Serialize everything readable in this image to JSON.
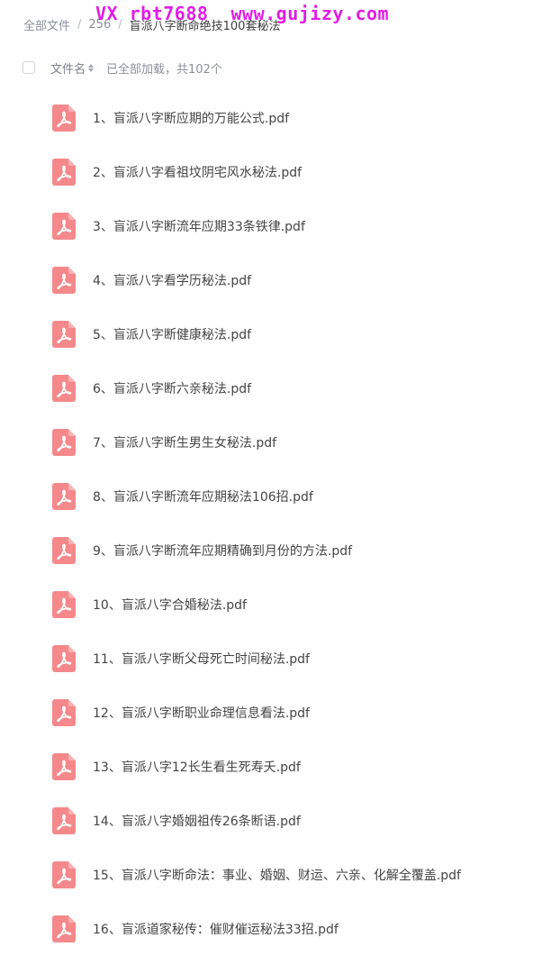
{
  "breadcrumb": {
    "root": "全部文件",
    "middle": "256",
    "current": "盲派八字断命绝技100套秘法",
    "separator": "/"
  },
  "watermark": {
    "text": "VX rbt7688  www.gujizy.com",
    "color": "#e21ce6"
  },
  "header": {
    "column_name": "文件名",
    "status": "已全部加载，共102个"
  },
  "colors": {
    "pdf_icon": "#f5888a",
    "accent": "#e21ce6"
  },
  "files": [
    {
      "name": "1、盲派八字断应期的万能公式.pdf",
      "icon": "pdf-icon"
    },
    {
      "name": "2、盲派八字看祖坟阴宅风水秘法.pdf",
      "icon": "pdf-icon"
    },
    {
      "name": "3、盲派八字断流年应期33条铁律.pdf",
      "icon": "pdf-icon"
    },
    {
      "name": "4、盲派八字看学历秘法.pdf",
      "icon": "pdf-icon"
    },
    {
      "name": "5、盲派八字断健康秘法.pdf",
      "icon": "pdf-icon"
    },
    {
      "name": "6、盲派八字断六亲秘法.pdf",
      "icon": "pdf-icon"
    },
    {
      "name": "7、盲派八字断生男生女秘法.pdf",
      "icon": "pdf-icon"
    },
    {
      "name": "8、盲派八字断流年应期秘法106招.pdf",
      "icon": "pdf-icon"
    },
    {
      "name": "9、盲派八字断流年应期精确到月份的方法.pdf",
      "icon": "pdf-icon"
    },
    {
      "name": "10、盲派八字合婚秘法.pdf",
      "icon": "pdf-icon"
    },
    {
      "name": "11、盲派八字断父母死亡时间秘法.pdf",
      "icon": "pdf-icon"
    },
    {
      "name": "12、盲派八字断职业命理信息看法.pdf",
      "icon": "pdf-icon"
    },
    {
      "name": "13、盲派八字12长生看生死寿夭.pdf",
      "icon": "pdf-icon"
    },
    {
      "name": "14、盲派八字婚姻祖传26条断语.pdf",
      "icon": "pdf-icon"
    },
    {
      "name": "15、盲派八字断命法：事业、婚姻、财运、六亲、化解全覆盖.pdf",
      "icon": "pdf-icon"
    },
    {
      "name": "16、盲派道家秘传：催财催运秘法33招.pdf",
      "icon": "pdf-icon"
    }
  ]
}
